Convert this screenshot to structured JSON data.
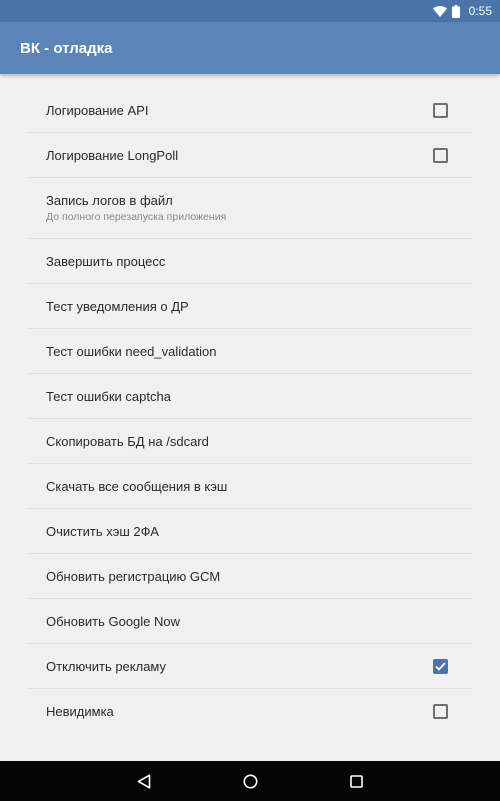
{
  "status_bar": {
    "time": "0:55",
    "icons": [
      "wifi-icon",
      "battery-icon"
    ]
  },
  "app_bar": {
    "title": "ВК - отладка"
  },
  "colors": {
    "accent": "#4a75a8",
    "app_bar": "#5b84b8",
    "background": "#f0f0f0"
  },
  "settings": {
    "items": [
      {
        "label": "Логирование API",
        "checked": false
      },
      {
        "label": "Логирование LongPoll",
        "checked": false
      },
      {
        "label": "Запись логов в файл",
        "summary": "До полного перезапуска приложения"
      },
      {
        "label": "Завершить процесс"
      },
      {
        "label": "Тест уведомления о ДР"
      },
      {
        "label": "Тест ошибки need_validation"
      },
      {
        "label": "Тест ошибки captcha"
      },
      {
        "label": "Скопировать БД на /sdcard"
      },
      {
        "label": "Скачать все сообщения в кэш"
      },
      {
        "label": "Очистить хэш 2ФА"
      },
      {
        "label": "Обновить регистрацию GCM"
      },
      {
        "label": "Обновить Google Now"
      },
      {
        "label": "Отключить рекламу",
        "checked": true
      },
      {
        "label": "Невидимка",
        "checked": false
      }
    ]
  },
  "nav_bar": {
    "icons": [
      "back-icon",
      "home-icon",
      "recents-icon"
    ]
  }
}
